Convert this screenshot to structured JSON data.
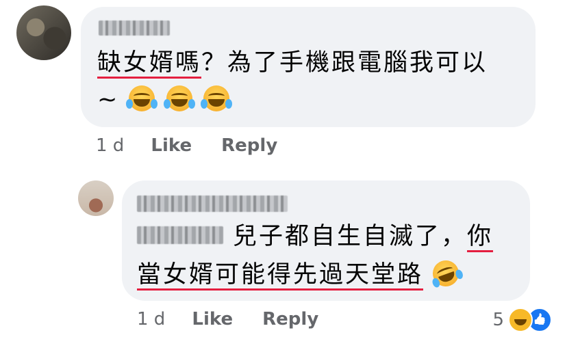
{
  "comment": {
    "text_line1_underlined": "缺女婿嗎",
    "text_line1_rest": "？為了手機跟電腦我可以",
    "text_line2": "~",
    "time": "1 d",
    "like_label": "Like",
    "reply_label": "Reply",
    "emoji_name": "tears-of-joy-emoji"
  },
  "reply": {
    "text_line1": "兒子都自生自滅了，",
    "text_line1_underlined": "你",
    "text_line2_underlined": "當女婿可能得先過天堂路",
    "emoji_name": "rofl-emoji",
    "time": "1 d",
    "like_label": "Like",
    "reply_label": "Reply",
    "reaction_count": "5",
    "reaction_icons": [
      "haha-reaction-icon",
      "like-reaction-icon"
    ]
  },
  "colors": {
    "bubble": "#f0f2f5",
    "meta_text": "#65676b",
    "underline": "#e41e3f",
    "like_blue": "#1877f2"
  }
}
